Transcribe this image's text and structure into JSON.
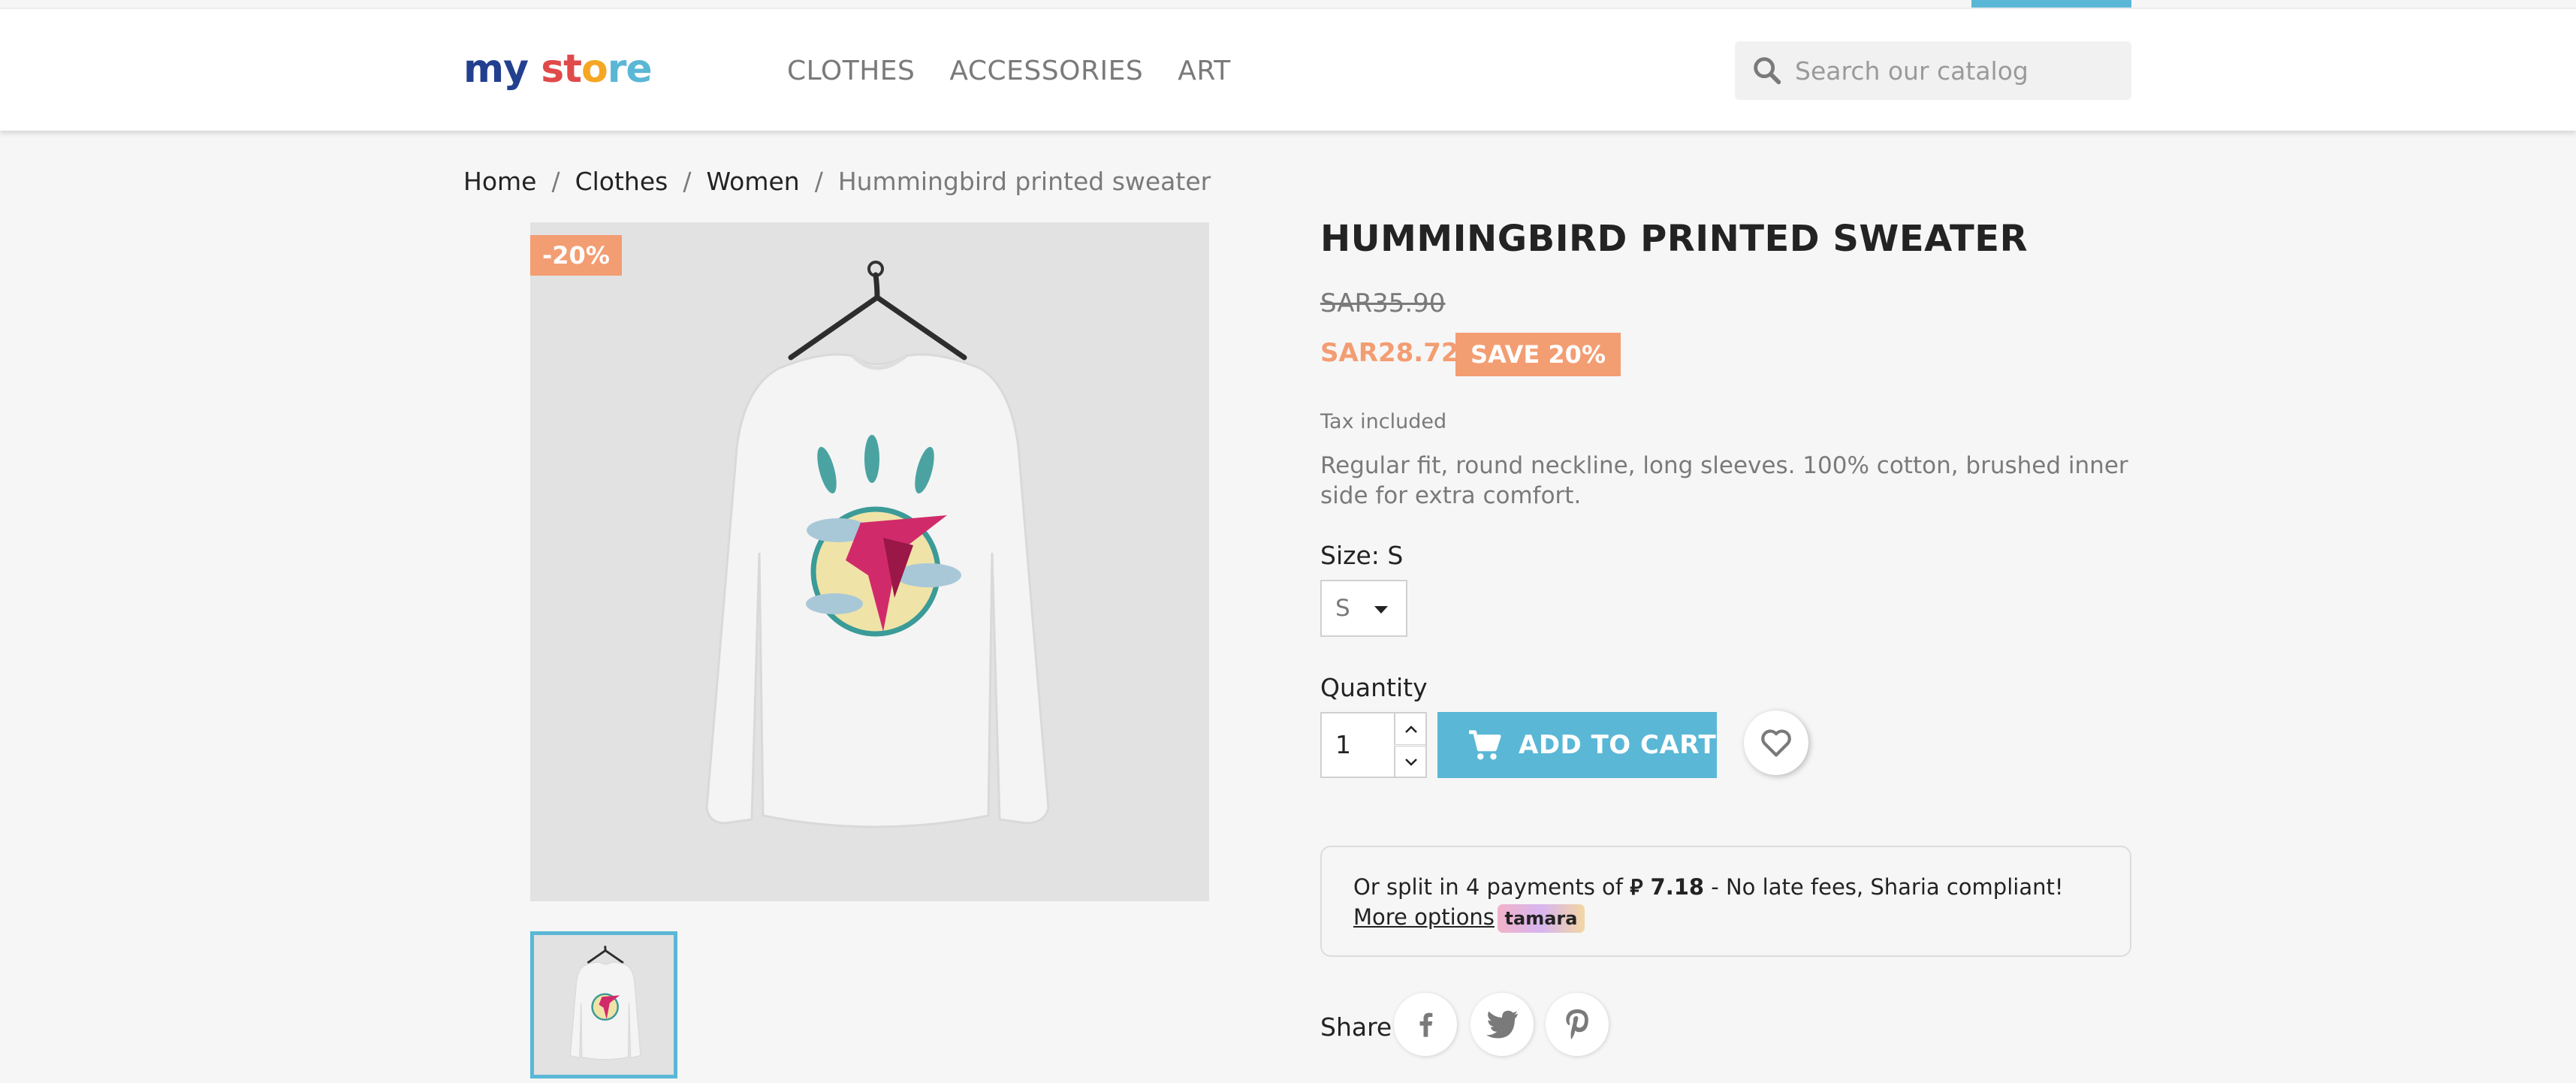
{
  "header": {
    "logo": {
      "parts": [
        "my",
        " ",
        "st",
        "o",
        "re"
      ],
      "colors": [
        "#233f8f",
        "#233f8f",
        "#233f8f",
        "#f5a623",
        "#e04a4a"
      ]
    },
    "nav": [
      {
        "label": "CLOTHES"
      },
      {
        "label": "ACCESSORIES"
      },
      {
        "label": "ART"
      }
    ],
    "search": {
      "placeholder": "Search our catalog",
      "icon": "search-icon"
    }
  },
  "breadcrumb": {
    "items": [
      "Home",
      "Clothes",
      "Women"
    ],
    "separator": "/",
    "current": "Hummingbird printed sweater"
  },
  "product": {
    "discount_flag": "-20%",
    "title": "HUMMINGBIRD PRINTED SWEATER",
    "old_price": "SAR35.90",
    "price": "SAR28.72",
    "save_badge": "SAVE 20%",
    "tax": "Tax included",
    "description": "Regular fit, round neckline, long sleeves. 100% cotton, brushed inner side for extra comfort.",
    "size": {
      "label": "Size: S",
      "selected": "S"
    },
    "quantity": {
      "label": "Quantity",
      "value": "1"
    },
    "add_to_cart": "ADD TO CART"
  },
  "tamara": {
    "prefix": "Or split in 4 payments of",
    "amount": "⃁ 7.18",
    "suffix": "- No late fees, Sharia compliant!",
    "more_options": "More options",
    "brand": "tamara"
  },
  "share": {
    "label": "Share",
    "networks": [
      "facebook-icon",
      "twitter-icon",
      "pinterest-icon"
    ]
  },
  "colors": {
    "accent": "#5ab7d6",
    "sale": "#f39d72"
  }
}
